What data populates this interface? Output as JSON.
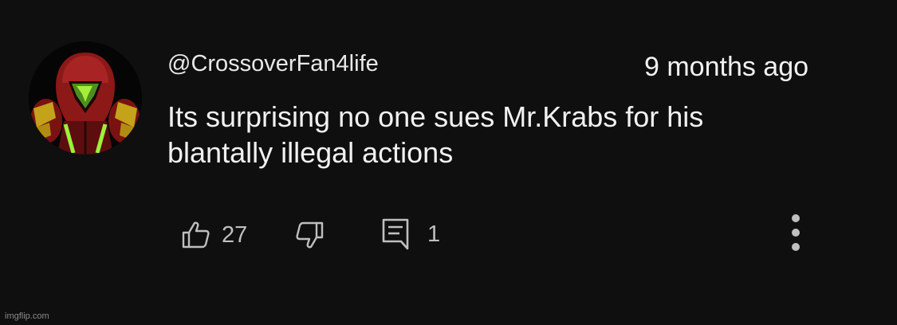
{
  "comment": {
    "username": "@CrossoverFan4life",
    "timestamp": "9 months ago",
    "text_line1": "Its surprising no one sues Mr.Krabs for his",
    "text_line2": "blantally illegal actions",
    "avatar_icon": "armored-helmet-avatar"
  },
  "actions": {
    "like_icon": "thumbs-up-icon",
    "like_count": "27",
    "dislike_icon": "thumbs-down-icon",
    "reply_icon": "comment-icon",
    "reply_count": "1",
    "more_icon": "vertical-dots-icon"
  },
  "watermark": "imgflip.com",
  "colors": {
    "background": "#0f0f0f",
    "text": "#f1f1f1",
    "secondary": "#bfbfbf"
  }
}
